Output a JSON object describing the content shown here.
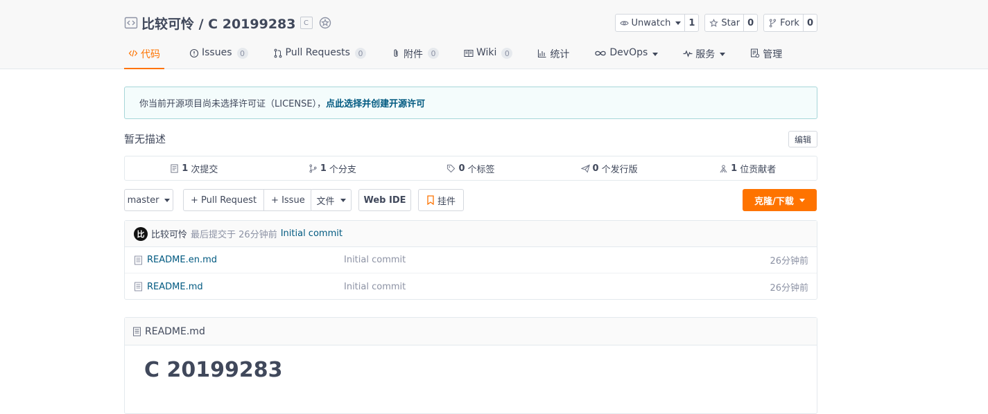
{
  "repo": {
    "title": "比较可怜 / C 20199283",
    "lang_badge": "C"
  },
  "actions": [
    {
      "label": "Unwatch",
      "count": "1"
    },
    {
      "label": "Star",
      "count": "0"
    },
    {
      "label": "Fork",
      "count": "0"
    }
  ],
  "tabs": [
    {
      "label": "代码",
      "badge": ""
    },
    {
      "label": "Issues",
      "badge": "0"
    },
    {
      "label": "Pull Requests",
      "badge": "0"
    },
    {
      "label": "附件",
      "badge": "0"
    },
    {
      "label": "Wiki",
      "badge": "0"
    },
    {
      "label": "统计",
      "badge": ""
    },
    {
      "label": "DevOps",
      "badge": ""
    },
    {
      "label": "服务",
      "badge": ""
    },
    {
      "label": "管理",
      "badge": ""
    }
  ],
  "license": {
    "text": "你当前开源项目尚未选择许可证（LICENSE），",
    "link": "点此选择并创建开源许可"
  },
  "description": "暂无描述",
  "edit_label": "编辑",
  "stats": [
    {
      "num": "1",
      "label": "次提交"
    },
    {
      "num": "1",
      "label": "个分支"
    },
    {
      "num": "0",
      "label": "个标签"
    },
    {
      "num": "0",
      "label": "个发行版"
    },
    {
      "num": "1",
      "label": "位贡献者"
    }
  ],
  "toolbar": {
    "branch": "master",
    "pull_request": "+ Pull Request",
    "issue": "+ Issue",
    "files": "文件",
    "web_ide": "Web IDE",
    "widget": "挂件",
    "clone": "克隆/下载"
  },
  "commit": {
    "avatar_char": "比",
    "author": "比较可怜",
    "meta": "最后提交于 26分钟前",
    "message": "Initial commit"
  },
  "files": [
    {
      "name": "README.en.md",
      "message": "Initial commit",
      "time": "26分钟前"
    },
    {
      "name": "README.md",
      "message": "Initial commit",
      "time": "26分钟前"
    }
  ],
  "readme": {
    "filename": "README.md",
    "heading": "C 20199283"
  }
}
